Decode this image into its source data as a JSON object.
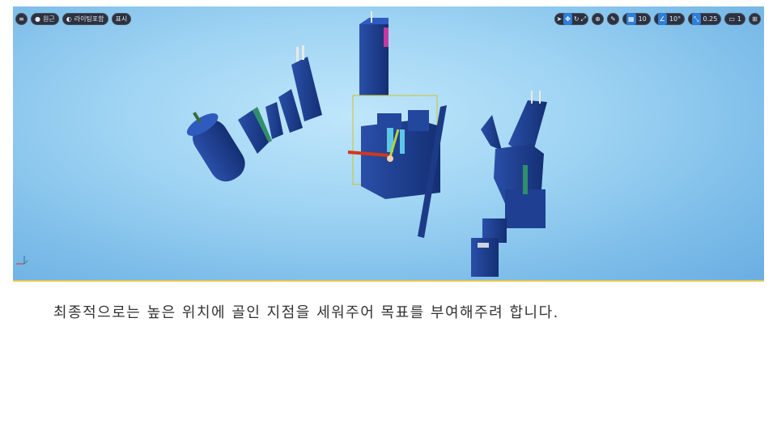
{
  "toolbar": {
    "left": {
      "menu_icon": "hamburger-menu-icon",
      "perspective_icon": "sphere-icon",
      "perspective_label": "원근",
      "lighting_icon": "lit-sphere-icon",
      "lighting_label": "라이팅포함",
      "show_label": "표시"
    },
    "right": {
      "transform_icons": [
        "select-arrow-icon",
        "move-icon",
        "rotate-icon",
        "scale-icon"
      ],
      "world_icon": "globe-icon",
      "surface_snap_icon": "surface-snap-icon",
      "grid_snap_value": "10",
      "rotation_snap_value": "10°",
      "scale_snap_value": "0.25",
      "camera_speed_value": "1",
      "layout_icon": "viewport-layout-icon"
    }
  },
  "caption": "최종적으로는 높은 위치에 골인 지점을 세워주어 목표를 부여해주려 합니다.",
  "colors": {
    "sky_center": "#bfe6fb",
    "sky_edge": "#6aaee2",
    "building": "#1f3f8f",
    "selection": "#c8c84a",
    "underline": "#e6c64e"
  }
}
